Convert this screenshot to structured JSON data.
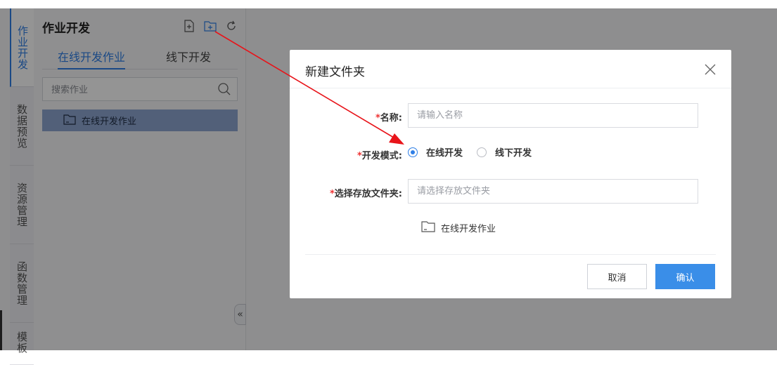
{
  "colors": {
    "accent": "#2f7fe6",
    "annotation_arrow": "#e8141a",
    "required_star": "#e33333",
    "confirm_button": "#3a8ee8"
  },
  "nav": {
    "items": [
      {
        "label": "作业开发"
      },
      {
        "label": "数据预览"
      },
      {
        "label": "资源管理"
      },
      {
        "label": "函数管理"
      },
      {
        "label": "模板"
      }
    ]
  },
  "panel": {
    "title": "作业开发",
    "tools": [
      "new-file-icon",
      "new-folder-icon",
      "refresh-icon"
    ],
    "tabs": [
      {
        "label": "在线开发作业"
      },
      {
        "label": "线下开发"
      }
    ],
    "search": {
      "placeholder": "搜索作业",
      "icon": "search-icon"
    },
    "tree": [
      {
        "label": "在线开发作业",
        "icon": "folder-icon"
      }
    ],
    "collapse": "«"
  },
  "dialog": {
    "title": "新建文件夹",
    "required_mark": "*",
    "name": {
      "label": "名称:",
      "placeholder": "请输入名称"
    },
    "mode": {
      "label": "开发模式:",
      "selected": "在线开发",
      "options": [
        {
          "label": "在线开发"
        },
        {
          "label": "线下开发"
        }
      ]
    },
    "folder": {
      "label": "选择存放文件夹:",
      "placeholder": "请选择存放文件夹",
      "option": "在线开发作业"
    },
    "cancel": "取消",
    "confirm": "确认"
  }
}
